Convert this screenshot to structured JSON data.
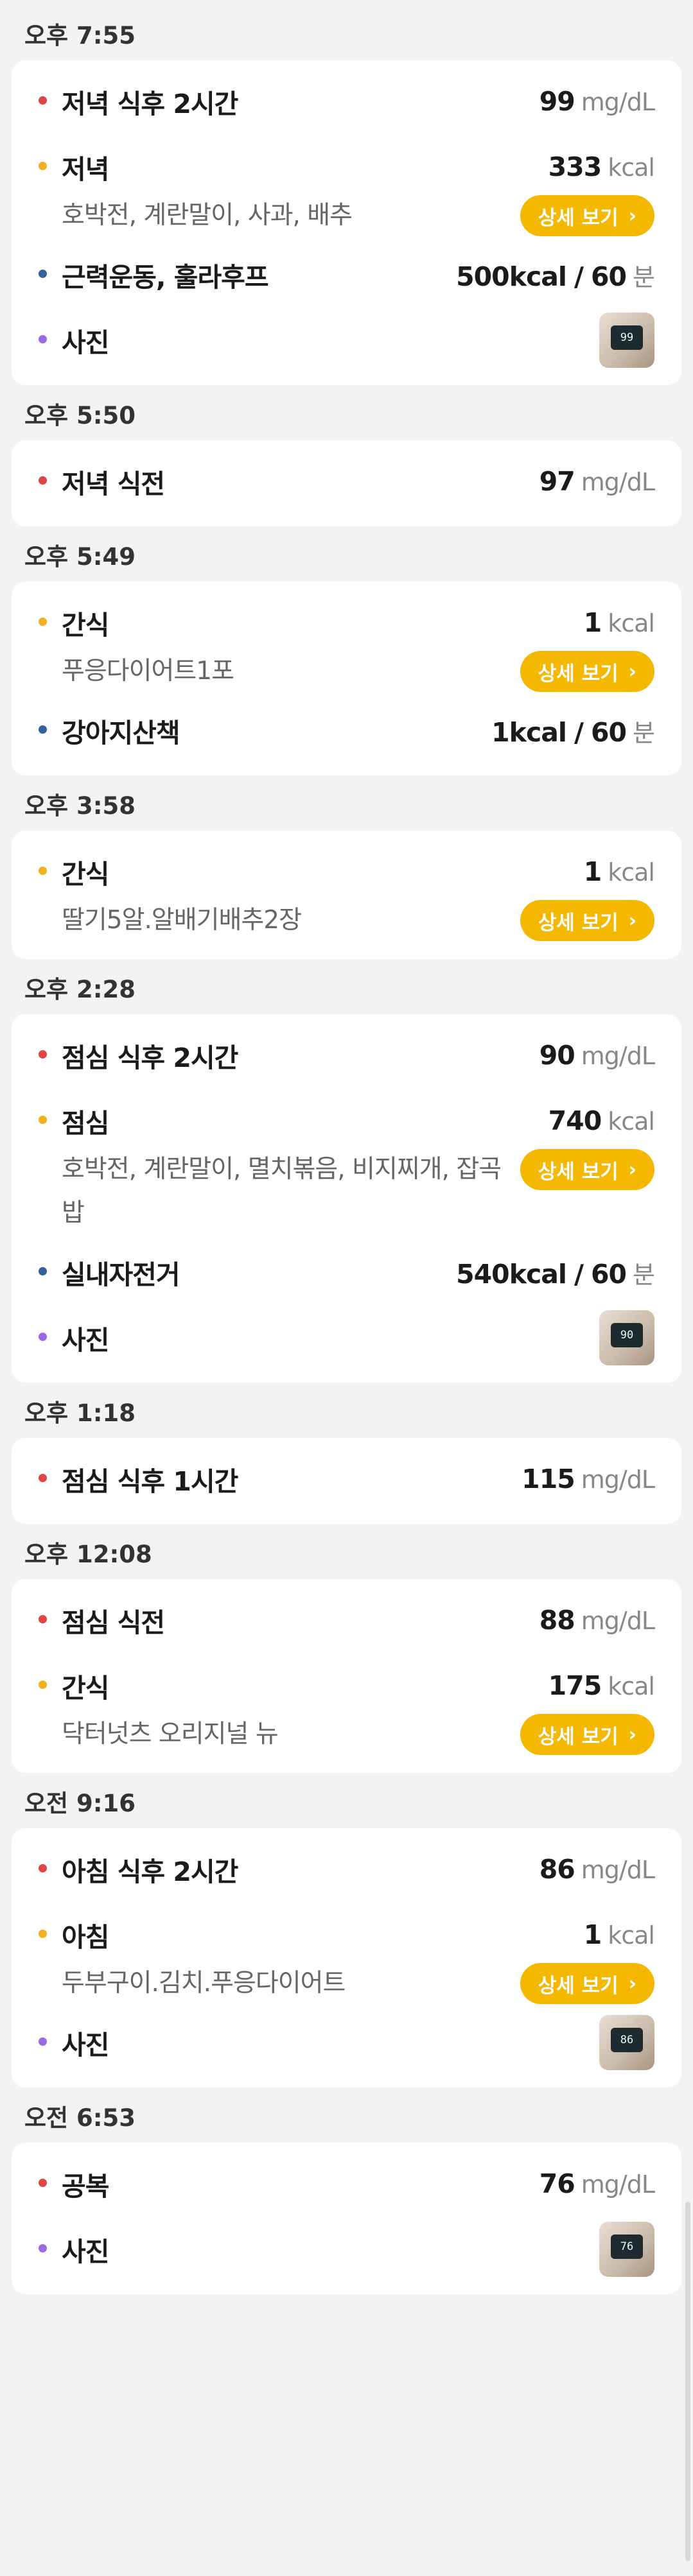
{
  "unit_bg": "mg/dL",
  "unit_kcal": "kcal",
  "unit_min": "분",
  "detail_label": "상세 보기",
  "groups": [
    {
      "time": "오후 7:55",
      "items": [
        {
          "type": "glucose",
          "label": "저녁 식후 2시간",
          "value": "99"
        },
        {
          "type": "meal",
          "label": "저녁",
          "value": "333",
          "desc": "호박전, 계란말이, 사과, 배추"
        },
        {
          "type": "exercise",
          "label": "근력운동, 훌라후프",
          "value": "500kcal",
          "minutes": "60"
        },
        {
          "type": "photo",
          "label": "사진",
          "screen": "99"
        }
      ]
    },
    {
      "time": "오후 5:50",
      "items": [
        {
          "type": "glucose",
          "label": "저녁 식전",
          "value": "97"
        }
      ]
    },
    {
      "time": "오후 5:49",
      "items": [
        {
          "type": "meal",
          "label": "간식",
          "value": "1",
          "desc": "푸응다이어트1포"
        },
        {
          "type": "exercise",
          "label": "강아지산책",
          "value": "1kcal",
          "minutes": "60"
        }
      ]
    },
    {
      "time": "오후 3:58",
      "items": [
        {
          "type": "meal",
          "label": "간식",
          "value": "1",
          "desc": "딸기5알.알배기배추2장"
        }
      ]
    },
    {
      "time": "오후 2:28",
      "items": [
        {
          "type": "glucose",
          "label": "점심 식후 2시간",
          "value": "90"
        },
        {
          "type": "meal",
          "label": "점심",
          "value": "740",
          "desc": "호박전, 계란말이, 멸치볶음, 비지찌개, 잡곡밥"
        },
        {
          "type": "exercise",
          "label": "실내자전거",
          "value": "540kcal",
          "minutes": "60"
        },
        {
          "type": "photo",
          "label": "사진",
          "screen": "90"
        }
      ]
    },
    {
      "time": "오후 1:18",
      "items": [
        {
          "type": "glucose",
          "label": "점심 식후 1시간",
          "value": "115"
        }
      ]
    },
    {
      "time": "오후 12:08",
      "items": [
        {
          "type": "glucose",
          "label": "점심 식전",
          "value": "88"
        },
        {
          "type": "meal",
          "label": "간식",
          "value": "175",
          "desc": "닥터넛츠 오리지널 뉴"
        }
      ]
    },
    {
      "time": "오전 9:16",
      "items": [
        {
          "type": "glucose",
          "label": "아침 식후 2시간",
          "value": "86"
        },
        {
          "type": "meal",
          "label": "아침",
          "value": "1",
          "desc": "두부구이.김치.푸응다이어트"
        },
        {
          "type": "photo",
          "label": "사진",
          "screen": "86"
        }
      ]
    },
    {
      "time": "오전 6:53",
      "items": [
        {
          "type": "glucose",
          "label": "공복",
          "value": "76"
        },
        {
          "type": "photo",
          "label": "사진",
          "screen": "76"
        }
      ]
    }
  ],
  "colors": {
    "glucose": "#e04545",
    "meal": "#f2b01e",
    "exercise": "#34609e",
    "photo": "#9b69e6",
    "button": "#f5b800"
  }
}
